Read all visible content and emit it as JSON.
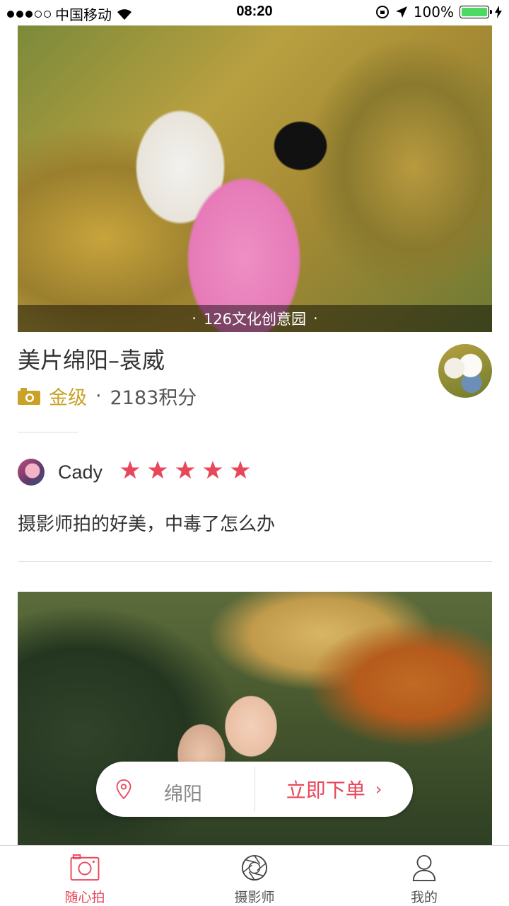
{
  "status_bar": {
    "carrier": "中国移动",
    "time": "08:20",
    "battery": "100%"
  },
  "feed": {
    "card1": {
      "photo_caption": "126文化创意园",
      "photographer_name": "美片绵阳–袁威",
      "level": "金级",
      "separator": "·",
      "points": "2183积分"
    },
    "review": {
      "reviewer": "Cady",
      "rating": 5,
      "text": "摄影师拍的好美，中毒了怎么办"
    }
  },
  "order_bar": {
    "city": "绵阳",
    "cta": "立即下单",
    "chevron": "›"
  },
  "tabs": [
    {
      "label": "随心拍",
      "icon": "camera-icon",
      "active": true
    },
    {
      "label": "摄影师",
      "icon": "aperture-icon",
      "active": false
    },
    {
      "label": "我的",
      "icon": "user-icon",
      "active": false
    }
  ],
  "colors": {
    "accent": "#e8475a",
    "gold": "#c9a227"
  }
}
